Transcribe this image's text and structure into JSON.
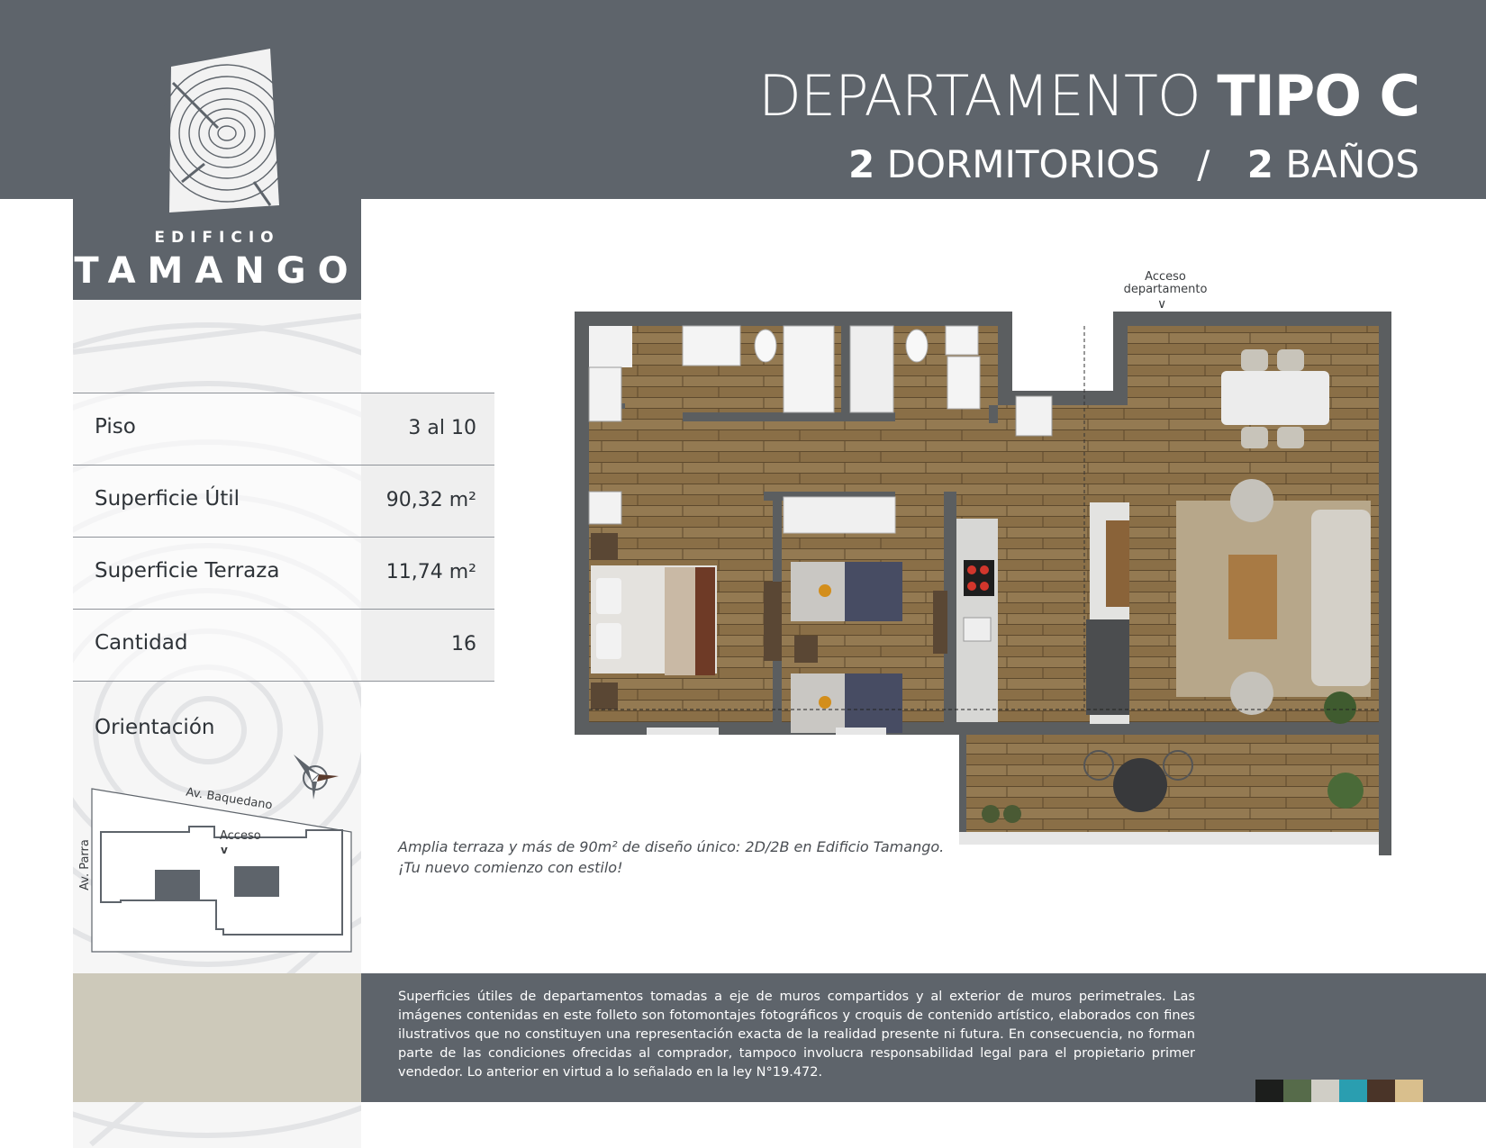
{
  "header": {
    "title_light": "DEPARTAMENTO",
    "title_bold": "TIPO C",
    "bedrooms_num": "2",
    "bedrooms_label": "DORMITORIOS",
    "separator": "/",
    "baths_num": "2",
    "baths_label": "BAÑOS"
  },
  "logo": {
    "small": "EDIFICIO",
    "big": "TAMANGO"
  },
  "specs": [
    {
      "label": "Piso",
      "value": "3 al 10"
    },
    {
      "label": "Superficie Útil",
      "value": "90,32 m²"
    },
    {
      "label": "Superficie Terraza",
      "value": "11,74 m²"
    },
    {
      "label": "Cantidad",
      "value": "16"
    }
  ],
  "orientation": {
    "label": "Orientación",
    "street_top": "Av. Baquedano",
    "street_side": "Av. Parra",
    "access": "Acceso"
  },
  "plan": {
    "access_line1": "Acceso",
    "access_line2": "departamento"
  },
  "caption": {
    "line1": "Amplia terraza y más de 90m² de diseño único: 2D/2B en Edificio Tamango.",
    "line2": "¡Tu nuevo comienzo con estilo!"
  },
  "footer": {
    "disclaimer": "Superficies útiles de departamentos tomadas a eje de muros compartidos y al exterior de muros perimetrales. Las imágenes contenidas en este folleto son fotomontajes fotográficos y croquis de contenido artístico, elaborados con fines ilustrativos que no constituyen una representación exacta de la realidad presente ni futura. En consecuencia, no forman parte de las condiciones ofrecidas al comprador, tampoco involucra responsabilidad legal para el propietario primer vendedor. Lo anterior en virtud a lo señalado en la ley N°19.472.",
    "palette": [
      "#1c1e1c",
      "#566b4a",
      "#d0cec6",
      "#2a9eb0",
      "#4a3428",
      "#d9bf8d"
    ]
  }
}
